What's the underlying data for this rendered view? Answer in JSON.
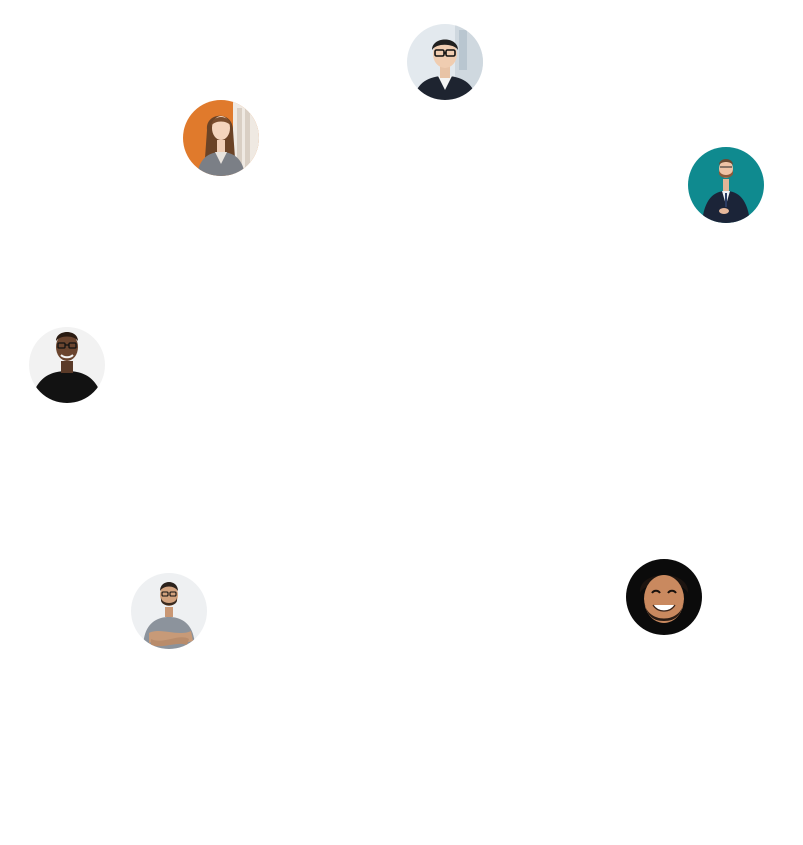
{
  "avatars": [
    {
      "id": "glasses-man-suit",
      "label": "",
      "bg": "#dfe6ea",
      "accent": "#1e2430"
    },
    {
      "id": "woman-gray-blazer",
      "label": "",
      "bg": "#e07a2c",
      "accent": "#7b7f86"
    },
    {
      "id": "man-navy-suit-teal",
      "label": "",
      "bg": "#0f8a8f",
      "accent": "#1b2438"
    },
    {
      "id": "man-black-tshirt",
      "label": "",
      "bg": "#f2f2f2",
      "accent": "#121212"
    },
    {
      "id": "man-gray-tshirt-arms-crossed",
      "label": "",
      "bg": "#eef0f2",
      "accent": "#8c939c"
    },
    {
      "id": "smiling-bearded-man-dark",
      "label": "",
      "bg": "#0b0b0b",
      "accent": "#2a1c14"
    }
  ]
}
